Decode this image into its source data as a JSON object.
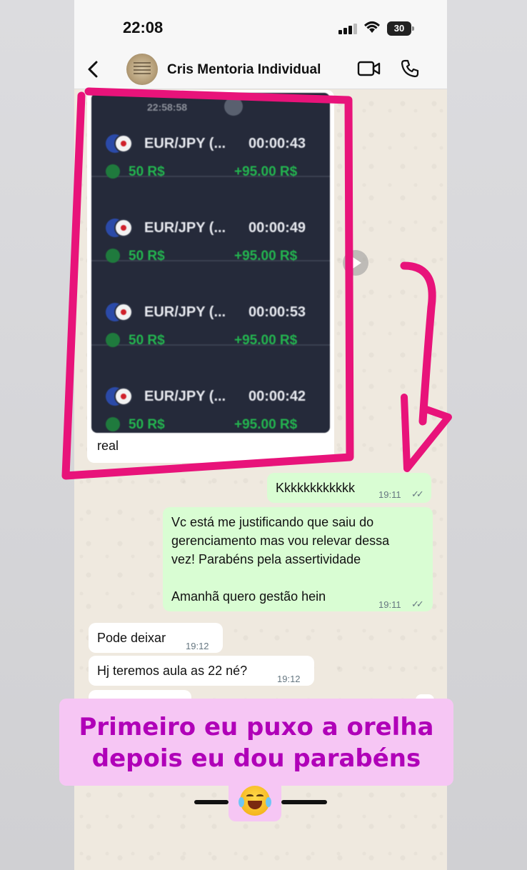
{
  "status_bar": {
    "time": "22:08",
    "battery": "30"
  },
  "header": {
    "contact_name": "Cris Mentoria Individual"
  },
  "image_message": {
    "top_text": "22:58:58",
    "trades": [
      {
        "pair": "EUR/JPY (...",
        "duration": "00:00:43",
        "amount": "50 R$",
        "profit": "+95.00 R$"
      },
      {
        "pair": "EUR/JPY (...",
        "duration": "00:00:49",
        "amount": "50 R$",
        "profit": "+95.00 R$"
      },
      {
        "pair": "EUR/JPY (...",
        "duration": "00:00:53",
        "amount": "50 R$",
        "profit": "+95.00 R$"
      },
      {
        "pair": "EUR/JPY (...",
        "duration": "00:00:42",
        "amount": "50 R$",
        "profit": "+95.00 R$"
      }
    ],
    "caption": "real"
  },
  "messages": {
    "m1": {
      "text": "Kkkkkkkkkkkk",
      "time": "19:11"
    },
    "m2": {
      "line1": "Vc está me justificando que saiu do",
      "line2": "gerenciamento mas vou relevar dessa",
      "line3": "vez! Parabéns pela assertividade",
      "line4": "Amanhã quero gestão hein",
      "time": "19:11"
    },
    "m3": {
      "text": "Pode deixar",
      "time": "19:12"
    },
    "m4": {
      "text": "Hj teremos aula as 22 né?",
      "time": "19:12"
    }
  },
  "banner": {
    "line1": "Primeiro eu puxo a orelha",
    "line2": "depois eu dou parabéns"
  },
  "colors": {
    "annotation": "#e8137a",
    "banner_bg": "#f6c6f4",
    "banner_text": "#b000b8",
    "outgoing_bubble": "#d9fdd3"
  },
  "icons": [
    "back-chevron-icon",
    "video-call-icon",
    "phone-call-icon",
    "signal-icon",
    "wifi-icon",
    "battery-icon",
    "forward-icon",
    "double-check-icon",
    "tears-of-joy-emoji"
  ]
}
